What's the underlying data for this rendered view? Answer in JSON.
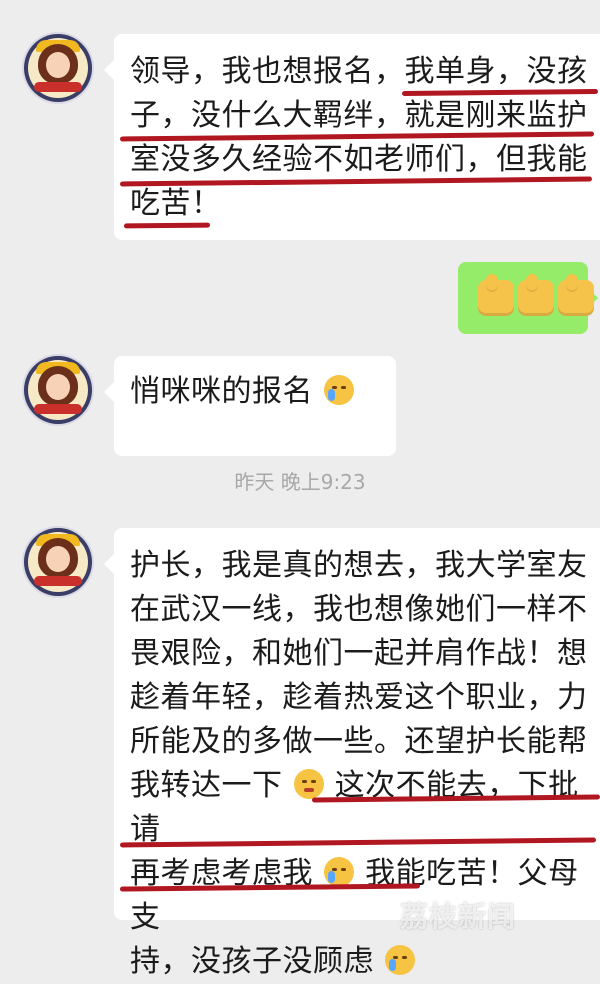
{
  "timestamp": "昨天 晚上9:23",
  "messages": [
    {
      "from": "left",
      "text": "领导，我也想报名，我单身，没孩子，没什么大羁绊，就是刚来监护室没多久经验不如老师们，但我能吃苦！"
    },
    {
      "from": "right",
      "emoji_names": [
        "thumbs-up",
        "thumbs-up",
        "thumbs-up"
      ]
    },
    {
      "from": "left",
      "text_prefix": "悄咪咪的报名",
      "emoji_name": "crying-face"
    },
    {
      "from": "left",
      "lines": [
        "护长，我是真的想去，我大学室友",
        "在武汉一线，我也想像她们一样不",
        "畏艰险，和她们一起并肩作战！想",
        "趁着年轻，趁着热爱这个职业，力",
        "所能及的多做一些。还望护长能帮",
        "我转达一下",
        "这次不能去，下批请",
        "再考虑考虑我",
        "我能吃苦！父母支",
        "持，没孩子没顾虑"
      ],
      "emoji_names": [
        "blushing-smile",
        "crying-face",
        "crying-face"
      ]
    }
  ],
  "colors": {
    "background": "#ededed",
    "bubble_left": "#ffffff",
    "bubble_right": "#95ec69",
    "underline": "#b11720",
    "timestamp": "#a8a8a8"
  },
  "watermark": "荔枝新闻"
}
